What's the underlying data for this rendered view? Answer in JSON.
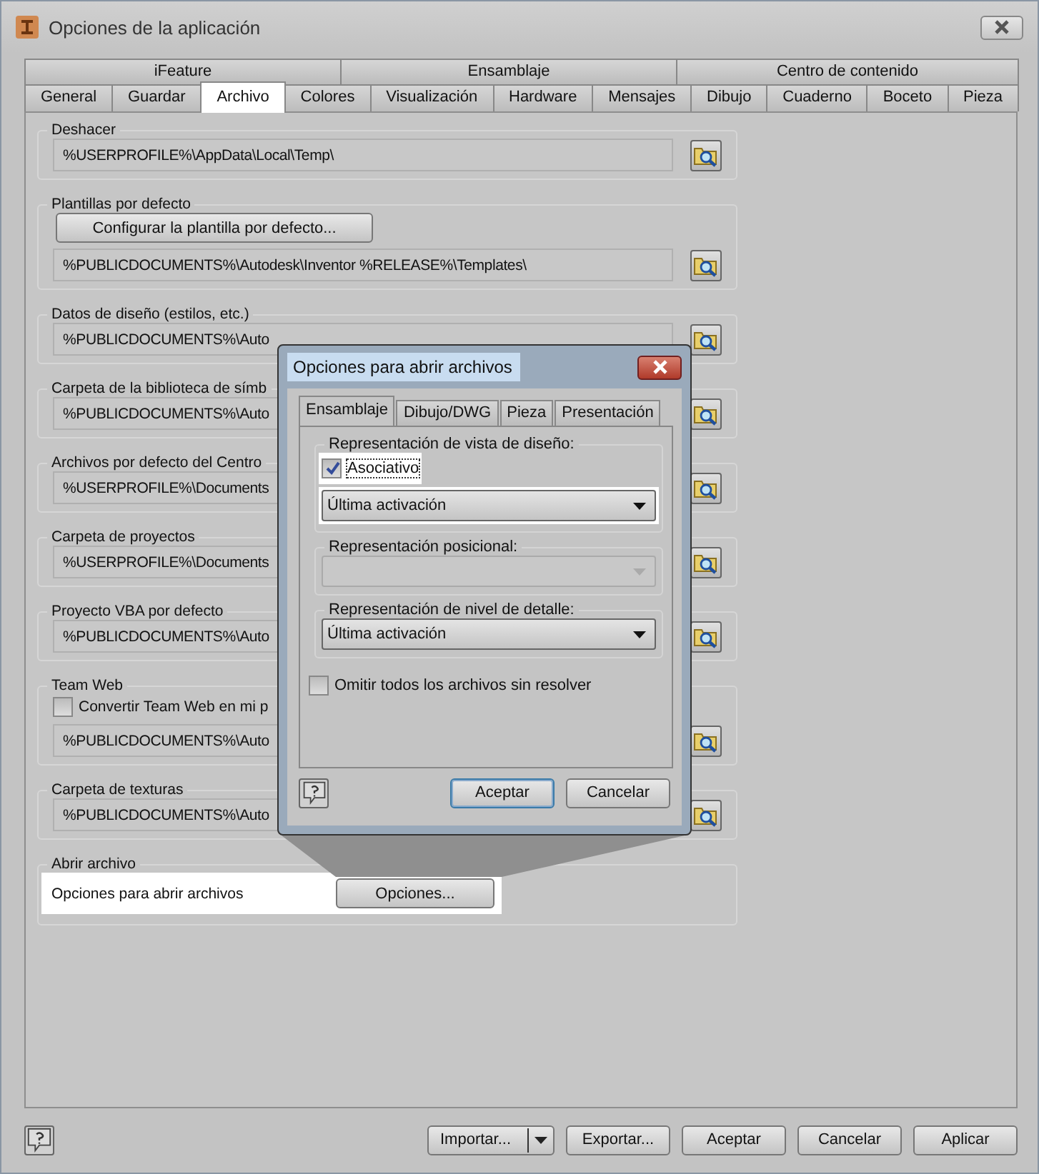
{
  "window": {
    "title": "Opciones de la aplicación"
  },
  "tab_rows": [
    [
      {
        "label": "iFeature",
        "selected": false
      },
      {
        "label": "Ensamblaje",
        "selected": false
      },
      {
        "label": "Centro de contenido",
        "selected": false
      }
    ],
    [
      {
        "label": "General",
        "selected": false
      },
      {
        "label": "Guardar",
        "selected": false
      },
      {
        "label": "Archivo",
        "selected": true
      },
      {
        "label": "Colores",
        "selected": false
      },
      {
        "label": "Visualización",
        "selected": false
      },
      {
        "label": "Hardware",
        "selected": false
      },
      {
        "label": "Mensajes",
        "selected": false
      },
      {
        "label": "Dibujo",
        "selected": false
      },
      {
        "label": "Cuaderno",
        "selected": false
      },
      {
        "label": "Boceto",
        "selected": false
      },
      {
        "label": "Pieza",
        "selected": false
      }
    ]
  ],
  "sections": [
    {
      "kind": "path",
      "label": "Deshacer",
      "path": "%USERPROFILE%\\AppData\\Local\\Temp\\"
    },
    {
      "kind": "template",
      "label": "Plantillas por defecto",
      "button": "Configurar la plantilla por defecto...",
      "path": "%PUBLICDOCUMENTS%\\Autodesk\\Inventor %RELEASE%\\Templates\\"
    },
    {
      "kind": "path",
      "label": "Datos de diseño (estilos, etc.)",
      "path": "%PUBLICDOCUMENTS%\\Auto"
    },
    {
      "kind": "path",
      "label": "Carpeta de la biblioteca de símb",
      "path": "%PUBLICDOCUMENTS%\\Auto"
    },
    {
      "kind": "path",
      "label": "Archivos por defecto del Centro",
      "path": "%USERPROFILE%\\Documents"
    },
    {
      "kind": "path",
      "label": "Carpeta de proyectos",
      "path": "%USERPROFILE%\\Documents"
    },
    {
      "kind": "path",
      "label": "Proyecto VBA por defecto",
      "path": "%PUBLICDOCUMENTS%\\Auto"
    },
    {
      "kind": "checkbox",
      "label": "Team Web",
      "checkbox": {
        "label": "Convertir Team Web en mi p",
        "checked": false
      },
      "path": "%PUBLICDOCUMENTS%\\Auto"
    },
    {
      "kind": "path",
      "label": "Carpeta de texturas",
      "path": "%PUBLICDOCUMENTS%\\Auto"
    },
    {
      "kind": "option",
      "label": "Abrir archivo",
      "text": "Opciones para abrir archivos",
      "button": "Opciones..."
    }
  ],
  "popup": {
    "title": "Opciones para abrir archivos",
    "tabs": [
      {
        "label": "Ensamblaje",
        "selected": true
      },
      {
        "label": "Dibujo/DWG",
        "selected": false
      },
      {
        "label": "Pieza",
        "selected": false
      },
      {
        "label": "Presentación",
        "selected": false
      }
    ],
    "groups": [
      {
        "label": "Representación de vista de diseño:",
        "checkbox": {
          "label": "Asociativo",
          "checked": true
        },
        "select": {
          "value": "Última activación",
          "disabled": false
        }
      },
      {
        "label": "Representación posicional:",
        "select": {
          "disabled": true
        }
      },
      {
        "label": "Representación de nivel de detalle:",
        "select": {
          "value": "Última activación",
          "disabled": false
        }
      }
    ],
    "omit": {
      "label": "Omitir todos los archivos sin resolver",
      "checked": false
    },
    "buttons": [
      {
        "label": "Aceptar",
        "default": true
      },
      {
        "label": "Cancelar",
        "default": false
      }
    ]
  },
  "footer": {
    "buttons": [
      {
        "label": "Importar...",
        "kind": "split"
      },
      {
        "label": "Exportar...",
        "kind": "plain"
      },
      {
        "label": "Aceptar",
        "kind": "plain"
      },
      {
        "label": "Cancelar",
        "kind": "plain"
      },
      {
        "label": "Aplicar",
        "kind": "plain"
      }
    ]
  }
}
